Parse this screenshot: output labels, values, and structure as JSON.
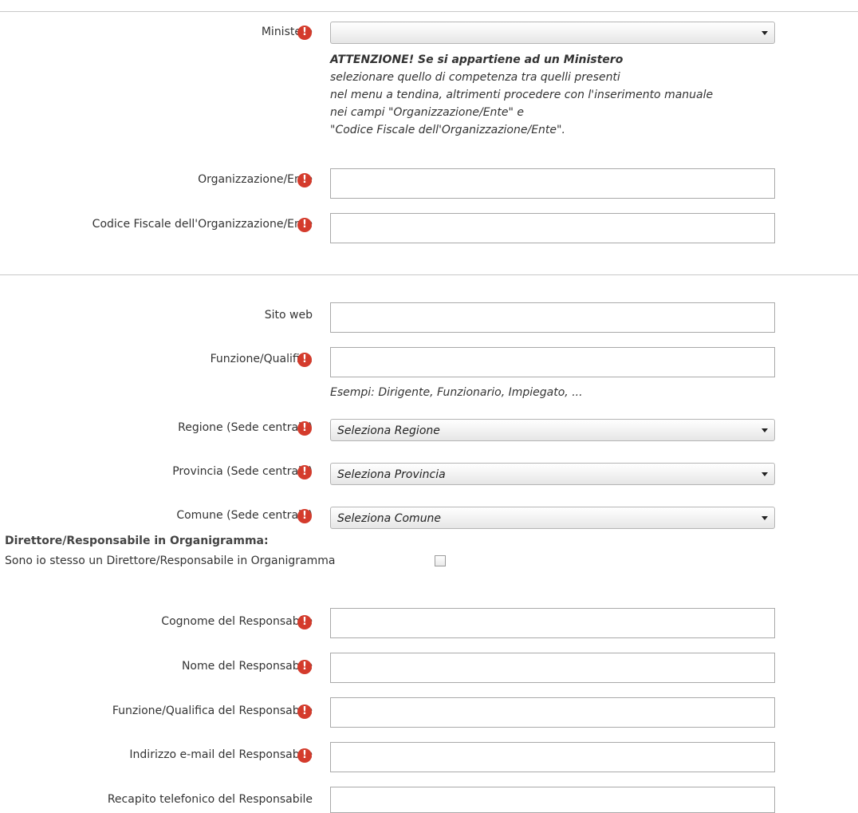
{
  "ministero": {
    "label": "Ministero",
    "value": "",
    "note_lines": [
      "ATTENZIONE! Se si appartiene ad un Ministero",
      "selezionare quello di competenza tra quelli presenti",
      "nel menu a tendina, altrimenti procedere con l'inserimento manuale",
      "nei campi \"Organizzazione/Ente\" e",
      "\"Codice Fiscale dell'Organizzazione/Ente\"."
    ]
  },
  "organizzazione": {
    "label": "Organizzazione/Ente",
    "value": ""
  },
  "codice_fiscale": {
    "label": "Codice Fiscale dell'Organizzazione/Ente",
    "value": ""
  },
  "sito_web": {
    "label": "Sito web",
    "value": ""
  },
  "funzione": {
    "label": "Funzione/Qualifica",
    "value": "",
    "hint": "Esempi: Dirigente, Funzionario, Impiegato, ..."
  },
  "regione": {
    "label": "Regione (Sede centrale)",
    "value": "Seleziona Regione"
  },
  "provincia": {
    "label": "Provincia (Sede centrale)",
    "value": "Seleziona Provincia"
  },
  "comune": {
    "label": "Comune (Sede centrale)",
    "value": "Seleziona Comune"
  },
  "direttore": {
    "title": "Direttore/Responsabile in Organigramma:",
    "self_label": "Sono io stesso un Direttore/Responsabile in Organigramma",
    "self_checked": false
  },
  "responsabile": {
    "cognome": {
      "label": "Cognome del Responsabile",
      "value": ""
    },
    "nome": {
      "label": "Nome del Responsabile",
      "value": ""
    },
    "funzione": {
      "label": "Funzione/Qualifica del Responsabile",
      "value": ""
    },
    "email": {
      "label": "Indirizzo e-mail del Responsabile",
      "value": ""
    },
    "telefono": {
      "label": "Recapito telefonico del Responsabile",
      "value": ""
    }
  },
  "required_icon": "exclamation-icon",
  "colors": {
    "required": "#d43b2c",
    "border": "#a9a9a9"
  }
}
